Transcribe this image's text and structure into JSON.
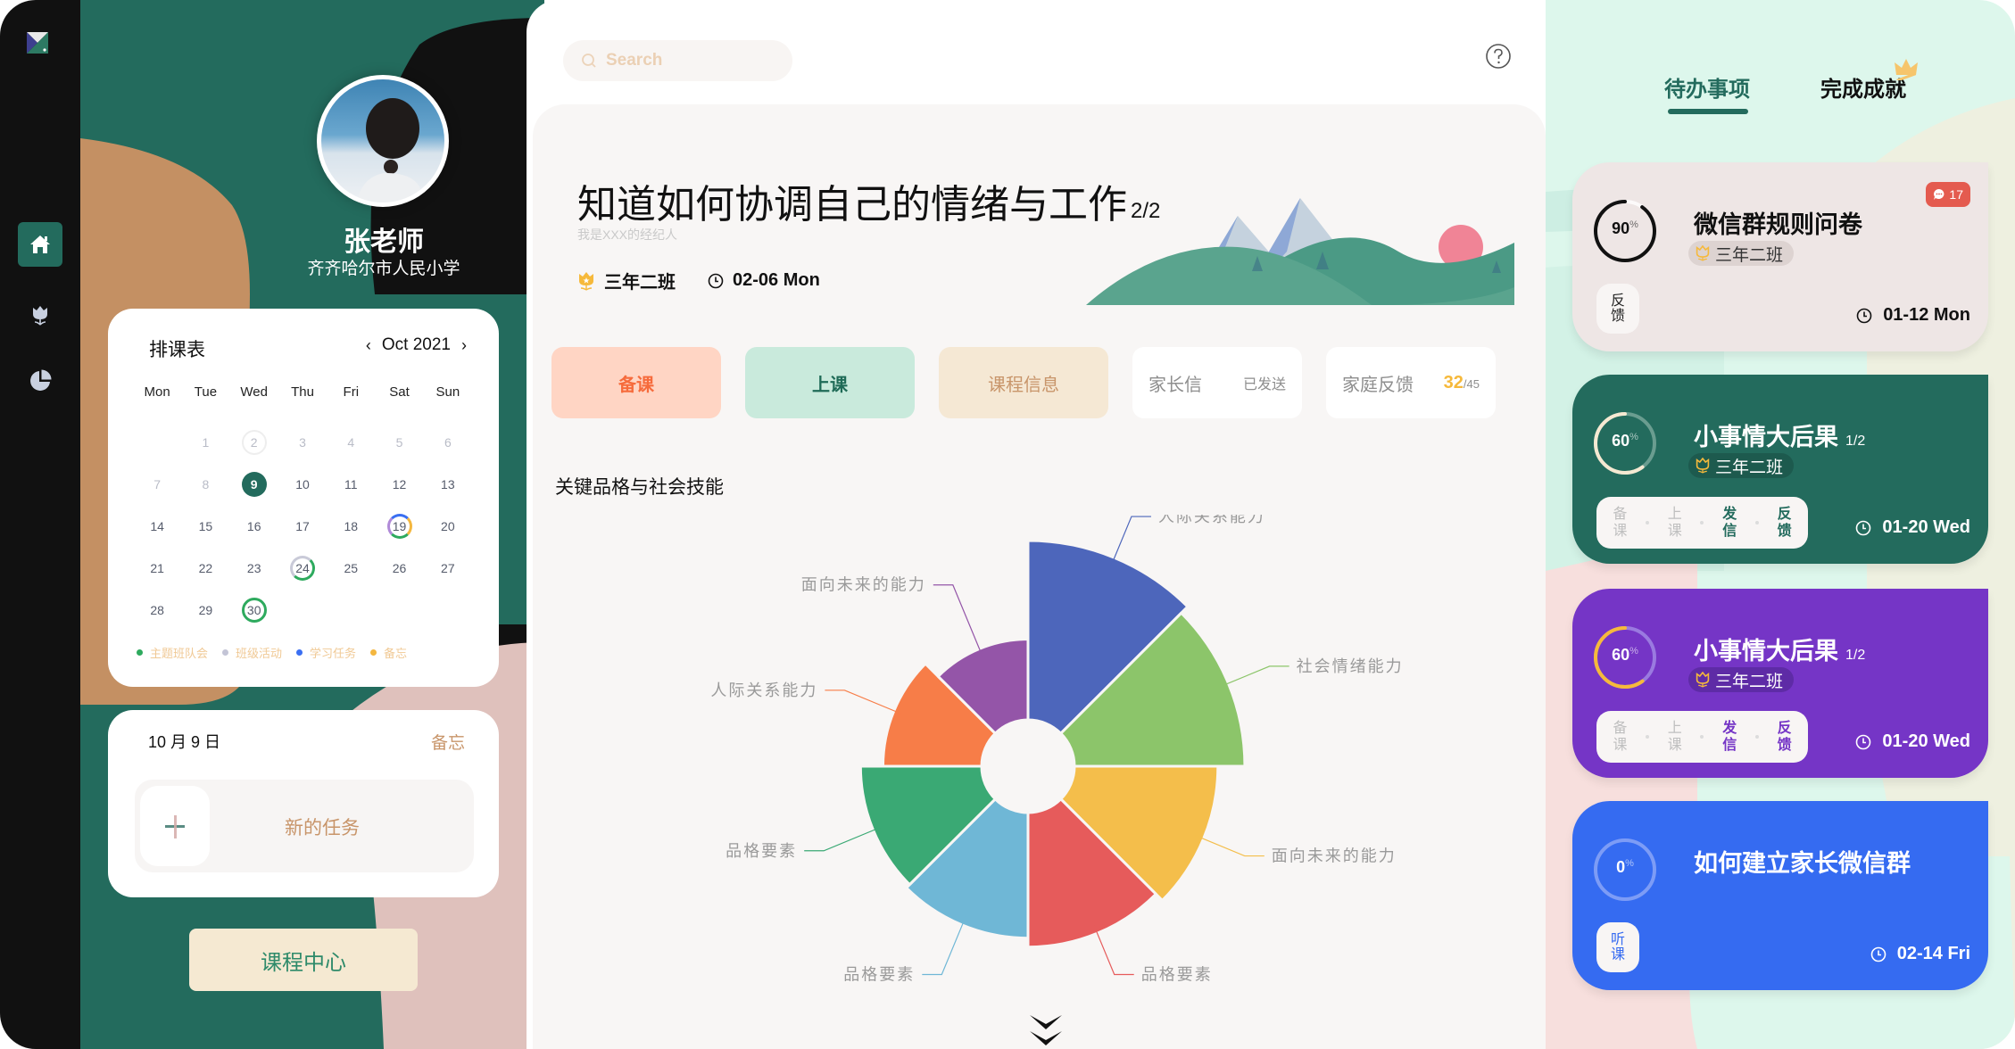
{
  "sidebar": {
    "items": [
      {
        "name": "home",
        "icon": "home-icon",
        "active": true
      },
      {
        "name": "flower",
        "icon": "tulip-icon",
        "active": false
      },
      {
        "name": "stats",
        "icon": "pie-chart-icon",
        "active": false
      }
    ],
    "logo": "app-logo"
  },
  "profile": {
    "name": "张老师",
    "school": "齐齐哈尔市人民小学"
  },
  "calendar": {
    "title": "排课表",
    "month_label": "Oct 2021",
    "prev_label": "‹",
    "next_label": "›",
    "weekdays": [
      "Mon",
      "Tue",
      "Wed",
      "Thu",
      "Fri",
      "Sat",
      "Sun"
    ],
    "days": [
      {
        "d": "",
        "s": "empty"
      },
      {
        "d": "1",
        "s": "muted"
      },
      {
        "d": "2",
        "s": "muted ring-grey"
      },
      {
        "d": "3",
        "s": "muted"
      },
      {
        "d": "4",
        "s": "muted"
      },
      {
        "d": "5",
        "s": "muted"
      },
      {
        "d": "6",
        "s": "muted"
      },
      {
        "d": "7",
        "s": "muted"
      },
      {
        "d": "8",
        "s": "muted"
      },
      {
        "d": "9",
        "s": "sel"
      },
      {
        "d": "10",
        "s": ""
      },
      {
        "d": "11",
        "s": ""
      },
      {
        "d": "12",
        "s": ""
      },
      {
        "d": "13",
        "s": ""
      },
      {
        "d": "14",
        "s": ""
      },
      {
        "d": "15",
        "s": ""
      },
      {
        "d": "16",
        "s": ""
      },
      {
        "d": "17",
        "s": ""
      },
      {
        "d": "18",
        "s": ""
      },
      {
        "d": "19",
        "s": "ring-multi"
      },
      {
        "d": "20",
        "s": ""
      },
      {
        "d": "21",
        "s": ""
      },
      {
        "d": "22",
        "s": ""
      },
      {
        "d": "23",
        "s": ""
      },
      {
        "d": "24",
        "s": "ring-half"
      },
      {
        "d": "25",
        "s": ""
      },
      {
        "d": "26",
        "s": ""
      },
      {
        "d": "27",
        "s": ""
      },
      {
        "d": "28",
        "s": ""
      },
      {
        "d": "29",
        "s": ""
      },
      {
        "d": "30",
        "s": "ring-green"
      }
    ],
    "legend": [
      {
        "label": "主题班队会",
        "color": "#2eaa5e"
      },
      {
        "label": "班级活动",
        "color": "#c3c4d6"
      },
      {
        "label": "学习任务",
        "color": "#3a6ff2"
      },
      {
        "label": "备忘",
        "color": "#f4b73f"
      }
    ]
  },
  "memo": {
    "date": "10 月 9 日",
    "link": "备忘",
    "new_task_label": "新的任务"
  },
  "course_center_label": "课程中心",
  "search": {
    "placeholder": "Search",
    "value": ""
  },
  "lesson": {
    "title": "知道如何协调自己的情绪与工作",
    "progress": "2/2",
    "subtitle": "我是XXX的经纪人",
    "class_name": "三年二班",
    "date": "02-06 Mon"
  },
  "actions": {
    "prepare": "备课",
    "teach": "上课",
    "course_info": "课程信息",
    "parent_letter": "家长信",
    "parent_letter_status": "已发送",
    "family_feedback": "家庭反馈",
    "feedback_count": "32",
    "feedback_total": "/45"
  },
  "chart_data": {
    "type": "pie",
    "rose_type": "radius",
    "title": "关键品格与社会技能",
    "start_angle": "12 o'clock, clockwise",
    "slices": [
      {
        "label": "人际关系能力",
        "value": 40,
        "color": "#4d66bb"
      },
      {
        "label": "社会情绪能力",
        "value": 38,
        "color": "#8cc56a"
      },
      {
        "label": "面向未来的能力",
        "value": 32,
        "color": "#f4be4b"
      },
      {
        "label": "品格要素",
        "value": 30,
        "color": "#e65b5b"
      },
      {
        "label": "品格要素",
        "value": 28,
        "color": "#6fb7d6"
      },
      {
        "label": "品格要素",
        "value": 27,
        "color": "#3aa974"
      },
      {
        "label": "人际关系能力",
        "value": 22,
        "color": "#f77d48"
      },
      {
        "label": "面向未来的能力",
        "value": 18,
        "color": "#9455a8"
      }
    ]
  },
  "right": {
    "tabs": [
      {
        "label": "待办事项",
        "active": true
      },
      {
        "label": "完成成就",
        "active": false
      }
    ],
    "tasks": [
      {
        "title": "微信群规则问卷",
        "progress_fraction": "",
        "percent": 90,
        "class_name": "三年二班",
        "date": "01-12 Mon",
        "badge_count": "17",
        "side_button": [
          "反",
          "馈"
        ],
        "theme": "light"
      },
      {
        "title": "小事情大后果",
        "progress_fraction": "1/2",
        "percent": 60,
        "class_name": "三年二班",
        "date": "01-20 Wed",
        "steps": [
          {
            "label": [
              "备",
              "课"
            ],
            "active": false
          },
          {
            "label": [
              "上",
              "课"
            ],
            "active": false
          },
          {
            "label": [
              "发",
              "信"
            ],
            "active": true
          },
          {
            "label": [
              "反",
              "馈"
            ],
            "active": true
          }
        ],
        "theme": "green"
      },
      {
        "title": "小事情大后果",
        "progress_fraction": "1/2",
        "percent": 60,
        "class_name": "三年二班",
        "date": "01-20 Wed",
        "steps": [
          {
            "label": [
              "备",
              "课"
            ],
            "active": false
          },
          {
            "label": [
              "上",
              "课"
            ],
            "active": false
          },
          {
            "label": [
              "发",
              "信"
            ],
            "active": true
          },
          {
            "label": [
              "反",
              "馈"
            ],
            "active": true
          }
        ],
        "theme": "purple"
      },
      {
        "title": "如何建立家长微信群",
        "progress_fraction": "",
        "percent": 0,
        "class_name": "",
        "date": "02-14 Fri",
        "side_button": [
          "听",
          "课"
        ],
        "theme": "blue"
      }
    ]
  },
  "colors": {
    "primary_green": "#236b5d",
    "accent_orange": "#f66b3c",
    "accent_gold": "#f6b93b",
    "tan": "#c8956a",
    "purple": "#7535c6",
    "blue": "#356bf1"
  }
}
